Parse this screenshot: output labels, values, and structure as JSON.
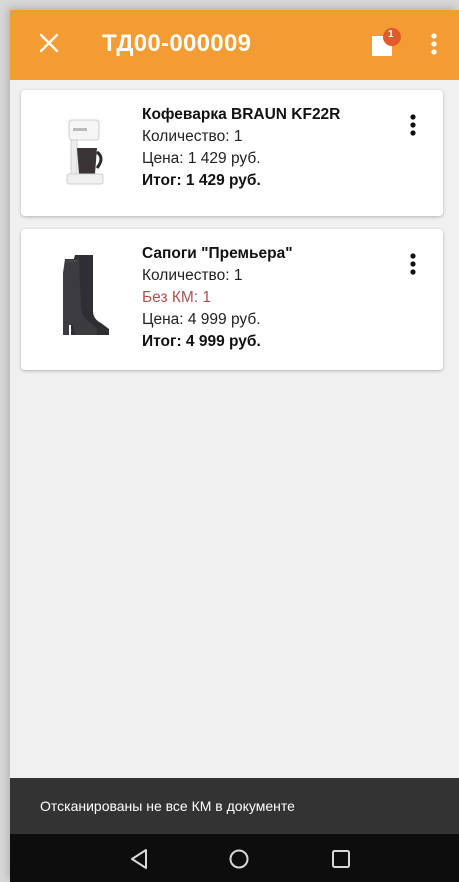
{
  "appbar": {
    "close_icon": "close-icon",
    "title": "ТД00-000009",
    "doc_icon": "document-badge-icon",
    "badge_text": "1",
    "more_icon": "more-vertical-icon",
    "background": "#f39c33"
  },
  "items": [
    {
      "name": "Кофеварка BRAUN KF22R",
      "quantity": "Количество: 1",
      "price": "Цена: 1 429 руб.",
      "total": "Итог: 1 429 руб.",
      "image_icon": "coffee-maker-icon"
    },
    {
      "name": "Сапоги \"Премьера\"",
      "quantity": "Количество: 1",
      "warning": "Без КМ: 1",
      "price": "Цена: 4 999 руб.",
      "total": "Итог: 4 999 руб.",
      "image_icon": "boot-icon"
    }
  ],
  "snackbar": {
    "message": "Отсканированы не все КМ в документе"
  },
  "navbar": {
    "back_icon": "back-icon",
    "home_icon": "home-icon",
    "recents_icon": "recents-icon"
  },
  "colors": {
    "accent": "#f39c33",
    "warning_text": "#b0524e",
    "snackbar_bg": "#333333",
    "navbar_bg": "#0d0d0d"
  }
}
